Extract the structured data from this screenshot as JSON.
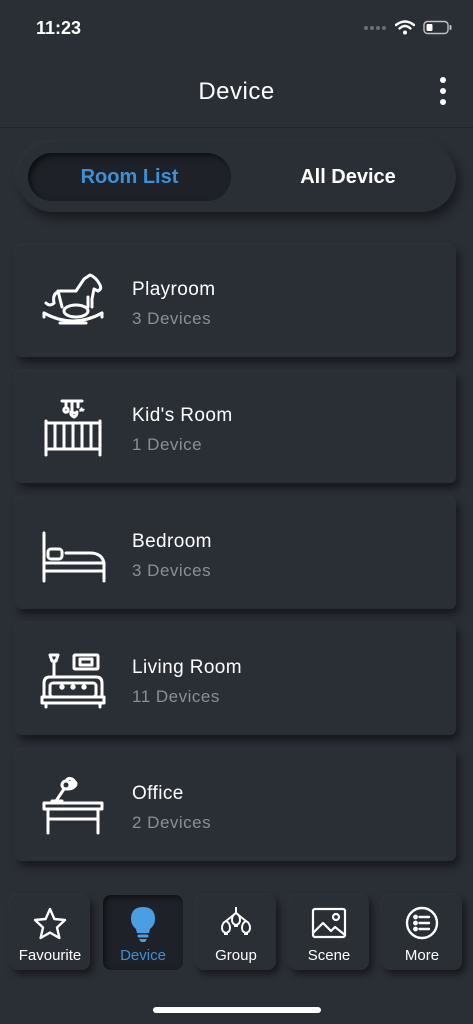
{
  "status_bar": {
    "time": "11:23"
  },
  "header": {
    "title": "Device"
  },
  "segment": {
    "room_list": "Room List",
    "all_device": "All Device"
  },
  "rooms": [
    {
      "name": "Playroom",
      "count": "3 Devices",
      "icon": "rocking-horse-icon"
    },
    {
      "name": "Kid's Room",
      "count": "1 Device",
      "icon": "crib-icon"
    },
    {
      "name": "Bedroom",
      "count": "3 Devices",
      "icon": "bed-icon"
    },
    {
      "name": "Living Room",
      "count": "11 Devices",
      "icon": "living-room-icon"
    },
    {
      "name": "Office",
      "count": "2 Devices",
      "icon": "desk-lamp-icon"
    }
  ],
  "tabs": [
    {
      "label": "Favourite",
      "icon": "star-icon"
    },
    {
      "label": "Device",
      "icon": "bulb-icon"
    },
    {
      "label": "Group",
      "icon": "chandelier-icon"
    },
    {
      "label": "Scene",
      "icon": "image-icon"
    },
    {
      "label": "More",
      "icon": "list-circle-icon"
    }
  ],
  "colors": {
    "background": "#2a2e35",
    "accent": "#3f8fd6",
    "secondary_text": "#8a8f96"
  }
}
